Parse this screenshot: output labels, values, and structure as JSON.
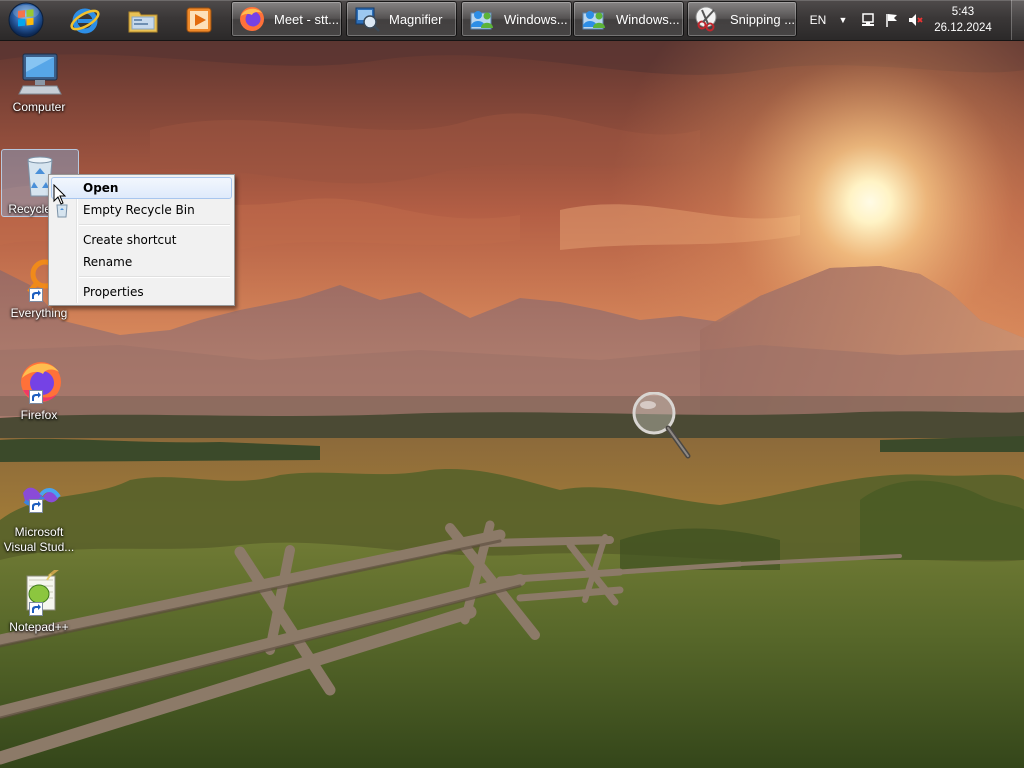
{
  "taskbar": {
    "pinned": [
      {
        "name": "internet-explorer"
      },
      {
        "name": "windows-explorer"
      },
      {
        "name": "media-player"
      }
    ],
    "tasks": [
      {
        "label": "Meet - stt..."
      },
      {
        "label": "Magnifier"
      },
      {
        "label": "Windows..."
      },
      {
        "label": "Windows..."
      },
      {
        "label": "Snipping ..."
      }
    ],
    "tray": {
      "language": "EN",
      "time": "5:43",
      "date": "26.12.2024"
    }
  },
  "desktop": {
    "icons": [
      {
        "label": "Computer"
      },
      {
        "label": "Recycle Bin"
      },
      {
        "label": "Everything"
      },
      {
        "label": "Firefox"
      },
      {
        "label": "Microsoft Visual Stud..."
      },
      {
        "label": "Notepad++"
      }
    ]
  },
  "context_menu": {
    "items": [
      {
        "label": "Open",
        "highlighted": true
      },
      {
        "label": "Empty Recycle Bin"
      },
      {
        "label": "Create shortcut"
      },
      {
        "label": "Rename"
      },
      {
        "label": "Properties"
      }
    ]
  },
  "colors": {
    "taskbar": "#3a3737",
    "menu_bg": "#f1f1f1",
    "menu_highlight": "#dfeafb"
  }
}
